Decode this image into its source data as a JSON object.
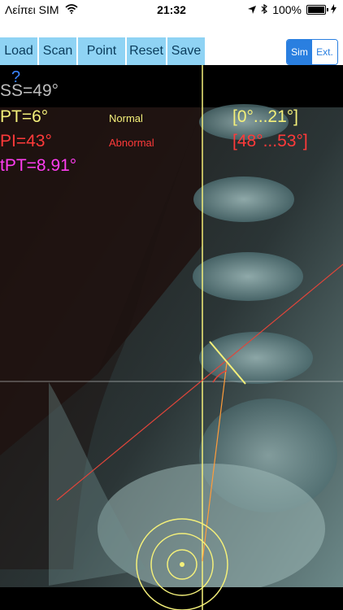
{
  "status": {
    "carrier": "Λείπει SIM",
    "time": "21:32",
    "battery": "100%"
  },
  "toolbar": {
    "load": "Load",
    "scan": "Scan",
    "point": "Point",
    "reset": "Reset",
    "save": "Save",
    "mode_sim": "Sim",
    "mode_ext": "Ext."
  },
  "overlay": {
    "help": "?",
    "ss": "SS=49°",
    "pt": "PT=6°",
    "pi": "PI=43°",
    "tpt": "tPT=8.91°",
    "pt_status": "Normal",
    "pi_status": "Abnormal",
    "pt_range": "[0°...21°]",
    "pi_range": "[48°...53°]"
  },
  "colors": {
    "toolbar_button": "#8fd3f4",
    "segment_accent": "#2a7fe0",
    "measure_yellow": "#f4f07a",
    "measure_red": "#ff3a3a",
    "measure_magenta": "#ff3df0",
    "measure_grey": "#bdbdbd"
  }
}
